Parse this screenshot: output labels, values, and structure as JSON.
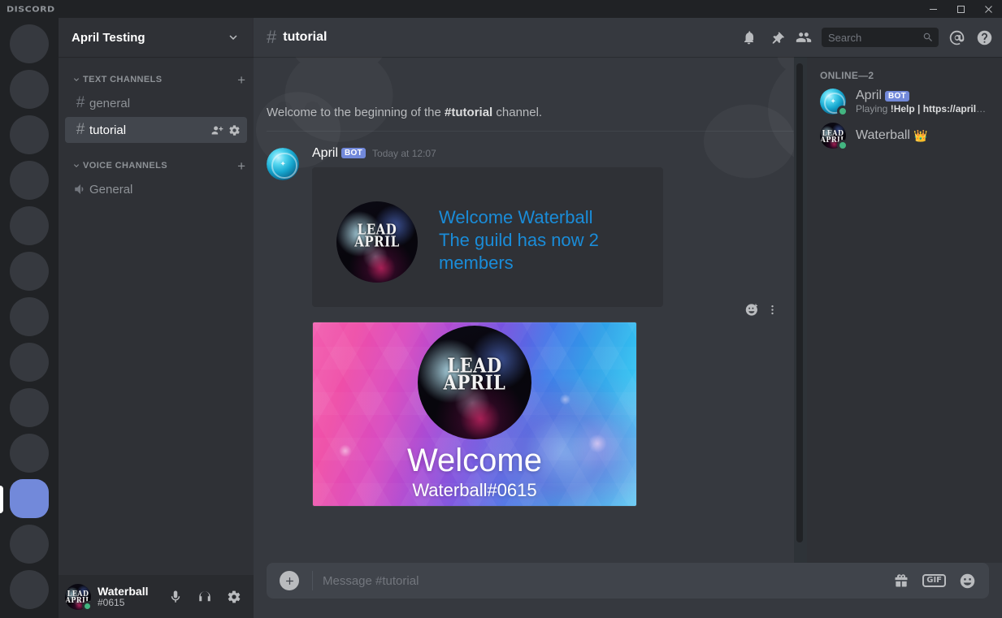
{
  "titlebar": {
    "app_name": "DISCORD",
    "minimize": "minimize-button",
    "maximize": "maximize-button",
    "close": "close-button"
  },
  "sidebar": {
    "guild_name": "April Testing",
    "categories": [
      {
        "label": "TEXT CHANNELS",
        "add_label": "+",
        "channels": [
          {
            "name": "general",
            "type": "text",
            "active": false
          },
          {
            "name": "tutorial",
            "type": "text",
            "active": true
          }
        ]
      },
      {
        "label": "VOICE CHANNELS",
        "add_label": "+",
        "channels": [
          {
            "name": "General",
            "type": "voice",
            "active": false
          }
        ]
      }
    ]
  },
  "user_panel": {
    "name": "Waterball",
    "discriminator": "#0615",
    "status": "online",
    "status_color": "#43b581",
    "buttons": [
      "microphone-button",
      "headphones-button",
      "user-settings-button"
    ]
  },
  "channel_header": {
    "hash": "#",
    "title": "tutorial",
    "icons": [
      "notifications-bell",
      "pinned-messages-pin",
      "member-list-people",
      "mentions-at",
      "help-question"
    ]
  },
  "search": {
    "placeholder": "Search",
    "value": ""
  },
  "chat": {
    "beginning_prefix": "Welcome to the beginning of the ",
    "beginning_channel": "#tutorial",
    "beginning_suffix": " channel.",
    "message": {
      "author": "April",
      "bot_tag": "BOT",
      "timestamp": "Today at 12:07",
      "embed": {
        "description_line1": "Welcome Waterball",
        "description_line2": "The guild has now 2",
        "description_line3": "members",
        "description_color": "#1a8cd8",
        "thumbnail_text": "LEAD APRIL"
      },
      "attachment": {
        "welcome_text": "Welcome",
        "username_text": "Waterball#0615",
        "avatar_text": "LEAD APRIL"
      },
      "hover_actions": [
        "add-reaction-icon",
        "more-options-icon"
      ]
    }
  },
  "message_input": {
    "placeholder": "Message #tutorial",
    "value": "",
    "upload_label": "+",
    "gif_label": "GIF",
    "buttons": [
      "upload-attachment-button",
      "gift-button",
      "gif-button",
      "emoji-button"
    ]
  },
  "members": {
    "header": "ONLINE—2",
    "list": [
      {
        "name": "April",
        "bot_tag": "BOT",
        "activity_prefix": "Playing ",
        "activity_bold": "!Help | https://aprilbot.me",
        "status_color": "#43b581",
        "crown": ""
      },
      {
        "name": "Waterball",
        "bot_tag": "",
        "activity_prefix": "",
        "activity_bold": "",
        "status_color": "#43b581",
        "crown": "👑"
      }
    ]
  },
  "colors": {
    "accent": "#7289da",
    "online": "#43b581",
    "sidebar_bg": "#2f3136",
    "chat_bg": "#36393f",
    "rail_bg": "#202225",
    "link_blue": "#1a8cd8"
  },
  "server_rail": {
    "items_count": 13,
    "active_index": 10
  }
}
